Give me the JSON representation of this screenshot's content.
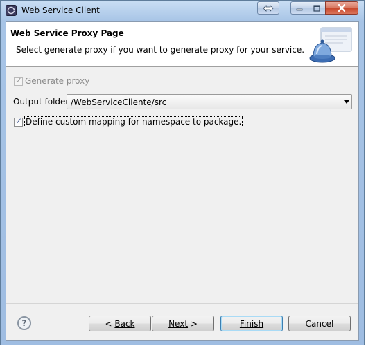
{
  "window": {
    "title": "Web Service Client",
    "controls": {
      "restore": "restore-icon",
      "minimize": "minimize-icon",
      "maximize": "maximize-icon",
      "close": "close-icon"
    }
  },
  "header": {
    "title": "Web Service Proxy Page",
    "description": "Select generate proxy if you want to generate proxy for your service."
  },
  "form": {
    "generate_proxy": {
      "label": "Generate proxy",
      "checked": true,
      "enabled": false
    },
    "output_folder": {
      "label": "Output folder",
      "value": "/WebServiceCliente/src"
    },
    "custom_mapping": {
      "label": "Define custom mapping for namespace to package.",
      "checked": true
    }
  },
  "footer": {
    "help_label": "?",
    "back_prefix": "< ",
    "back_label": "Back",
    "next_label": "Next",
    "next_suffix": " >",
    "finish_label": "Finish",
    "cancel_label": "Cancel"
  },
  "colors": {
    "titlebar": "#a7c4e6",
    "client": "#f0f0f0",
    "header_bg": "#ffffff",
    "default_button_border": "#3c7fb1"
  }
}
